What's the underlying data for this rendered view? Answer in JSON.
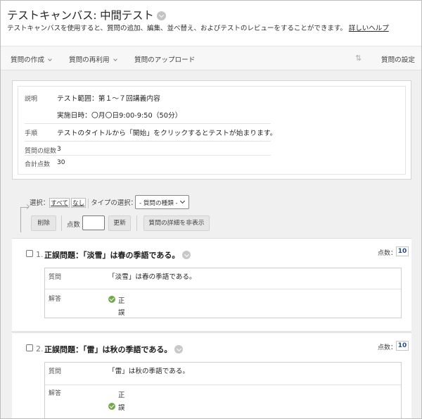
{
  "header": {
    "title": "テストキャンバス: 中間テスト",
    "description": "テストキャンバスを使用すると、質問の追加、編集、並べ替え、およびテストのレビューをすることができます。",
    "help_link": "詳しいヘルプ"
  },
  "toolbar": {
    "create_label": "質問の作成",
    "reuse_label": "質問の再利用",
    "upload_label": "質問のアップロード",
    "settings_label": "質問の設定",
    "sort_glyph": "⇅"
  },
  "info": {
    "description_label": "説明",
    "description_line1": "テスト範囲：第１～７回講義内容",
    "description_line2": "実施日時：〇月〇日9:00-9:50（50分）",
    "instructions_label": "手順",
    "instructions_text": "テストのタイトルから「開始」をクリックするとテストが始まります。",
    "total_questions_label": "質問の総数",
    "total_questions_value": "3",
    "total_points_label": "合計点数",
    "total_points_value": "30"
  },
  "controls": {
    "select_label": "選択：",
    "select_all": "すべて",
    "select_none": "なし",
    "type_label": "タイプの選択：",
    "type_dropdown_value": "- 質問の種類 -",
    "delete_button": "削除",
    "points_label": "点数",
    "points_input_value": "",
    "update_button": "更新",
    "hide_details_button": "質問の詳細を非表示"
  },
  "questions": [
    {
      "number": "1.",
      "title": "正誤問題：「淡雪」は春の季語である。",
      "points_label": "点数：",
      "points_value": "10",
      "question_label": "質問",
      "question_text": "「淡雪」は春の季語である。",
      "answer_label": "解答",
      "answers": [
        {
          "text": "正",
          "correct": true
        },
        {
          "text": "誤",
          "correct": false
        }
      ]
    },
    {
      "number": "2.",
      "title": "正誤問題：「雷」は秋の季語である。",
      "points_label": "点数：",
      "points_value": "10",
      "question_label": "質問",
      "question_text": "「雷」は秋の季語である。",
      "answer_label": "解答",
      "answers": [
        {
          "text": "正",
          "correct": false
        },
        {
          "text": "誤",
          "correct": true
        }
      ]
    }
  ],
  "colors": {
    "correct_check": "#71a94a",
    "points_value": "#1e4d8c",
    "page_background": "#f0f0f0"
  }
}
